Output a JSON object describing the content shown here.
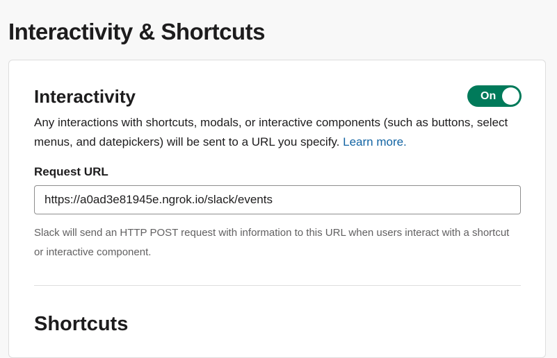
{
  "page": {
    "title": "Interactivity & Shortcuts"
  },
  "interactivity": {
    "title": "Interactivity",
    "toggle_label": "On",
    "description": "Any interactions with shortcuts, modals, or interactive components (such as buttons, select menus, and datepickers) will be sent to a URL you specify.",
    "learn_more": "Learn more.",
    "request_url_label": "Request URL",
    "request_url_value": "https://a0ad3e81945e.ngrok.io/slack/events",
    "help_text": "Slack will send an HTTP POST request with information to this URL when users interact with a shortcut or interactive component."
  },
  "shortcuts": {
    "title": "Shortcuts"
  },
  "colors": {
    "toggle_on": "#007a5a",
    "link": "#1264a3",
    "help_text": "#616061"
  }
}
